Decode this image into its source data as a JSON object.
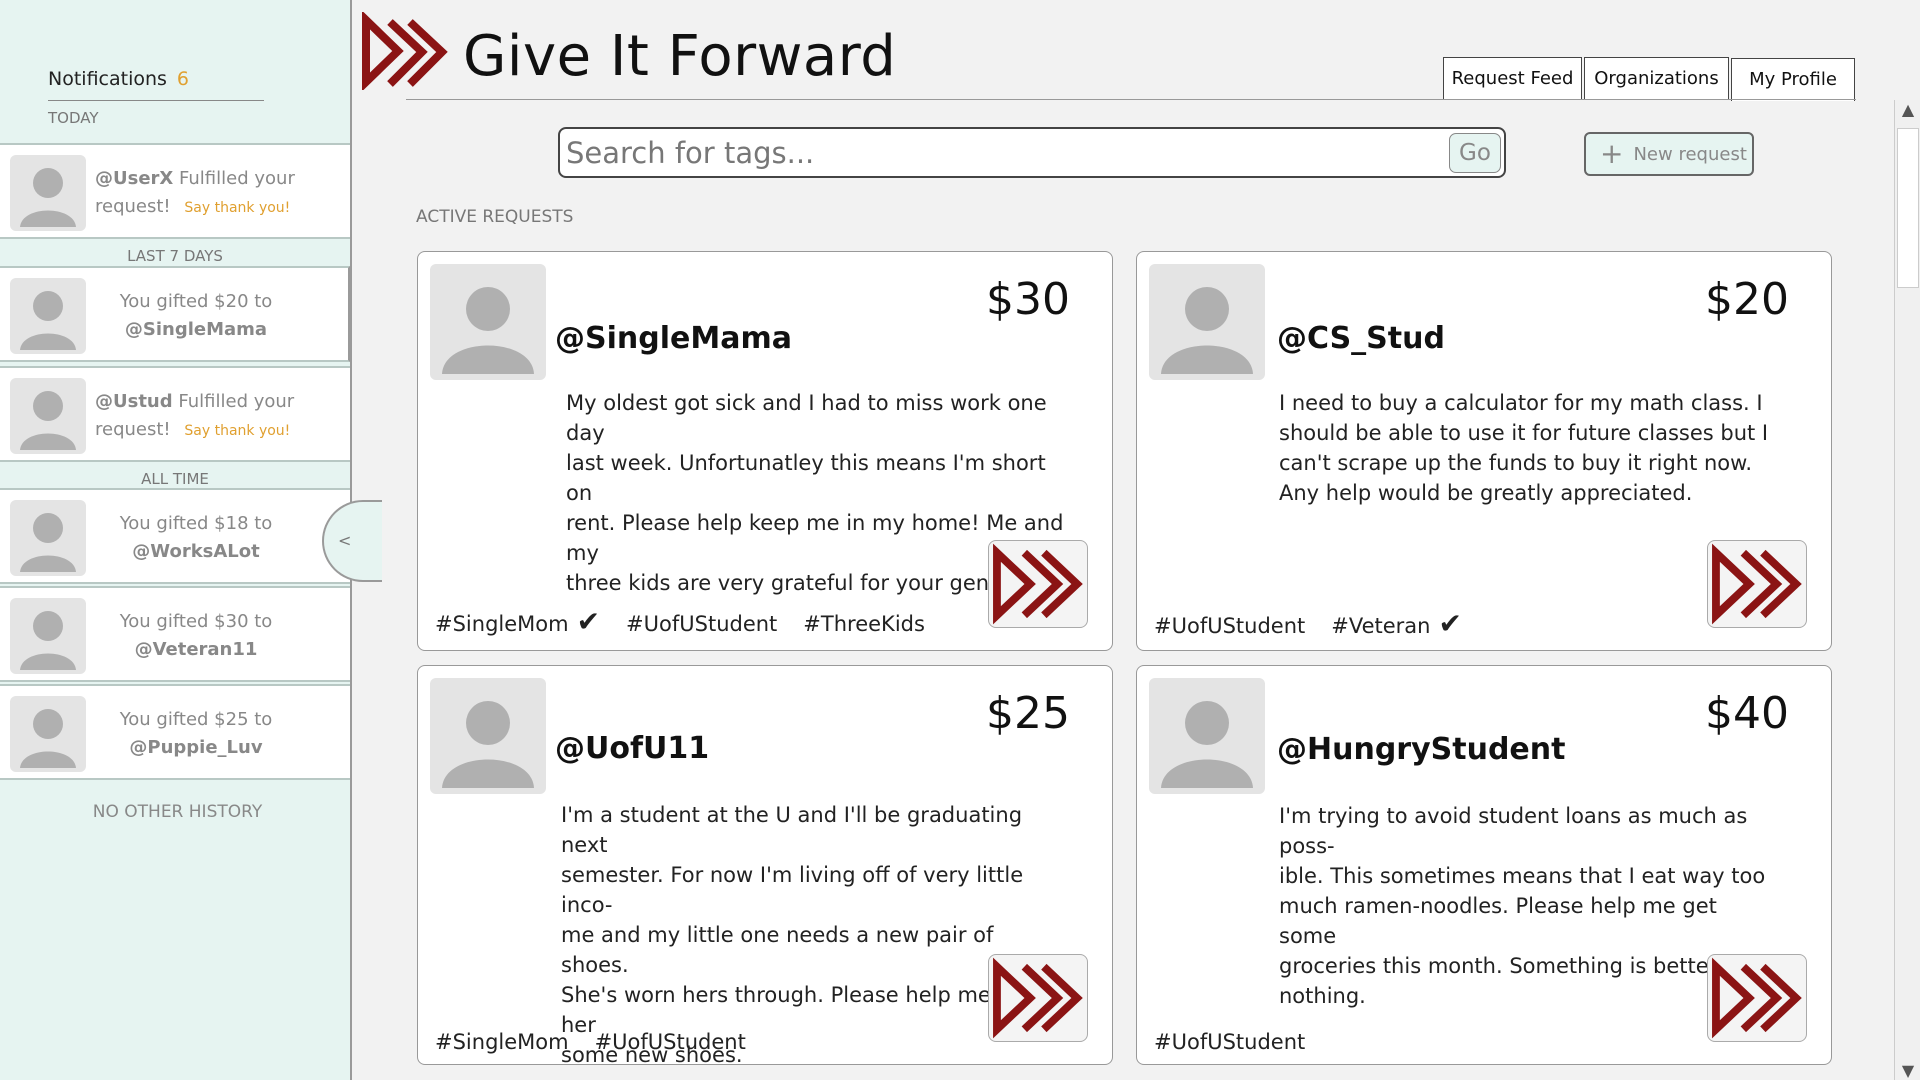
{
  "sidebar": {
    "title": "Notifications",
    "count": "6",
    "sections": {
      "today": "TODAY",
      "last7": "LAST 7 DAYS",
      "alltime": "ALL TIME"
    },
    "items": [
      {
        "user": "@UserX",
        "text": "Fulfilled your request!",
        "thanks": "Say thank you!"
      },
      {
        "prefix": "You gifted $20 to",
        "user": "@SingleMama"
      },
      {
        "user": "@Ustud",
        "text": "Fulfilled your request!",
        "thanks": "Say thank you!"
      },
      {
        "prefix": "You gifted $18 to",
        "user": "@WorksALot"
      },
      {
        "prefix": "You gifted $30 to",
        "user": "@Veteran11"
      },
      {
        "prefix": "You gifted $25 to",
        "user": "@Puppie_Luv"
      }
    ],
    "collapse_glyph": "<",
    "no_history": "NO OTHER HISTORY"
  },
  "header": {
    "title": "Give It Forward",
    "tabs": [
      "Request Feed",
      "Organizations",
      "My Profile"
    ]
  },
  "search": {
    "placeholder": "Search for tags...",
    "go_label": "Go"
  },
  "new_request_label": "New request",
  "active_label": "ACTIVE REQUESTS",
  "cards": [
    {
      "user": "@SingleMama",
      "amount": "$30",
      "desc_lines": [
        "My oldest got sick and I had to miss work one day",
        "last week. Unfortunatley this means I'm short on",
        "rent. Please help keep me in my home! Me and my",
        "three kids are very grateful for your generosity."
      ],
      "tags": [
        "#SingleMom",
        "#UofUStudent",
        "#ThreeKids"
      ]
    },
    {
      "user": "@CS_Stud",
      "amount": "$20",
      "desc_lines": [
        "I need to buy a calculator for my math class. I",
        "should be able to use it for future classes but I",
        "can't scrape up the funds to buy it right now.",
        "Any help would be greatly appreciated."
      ],
      "tags": [
        "#UofUStudent",
        "#Veteran"
      ]
    },
    {
      "user": "@UofU11",
      "amount": "$25",
      "desc_lines": [
        "I'm a student at the U and I'll be graduating next",
        "semester. For now I'm living off of very little inco-",
        "me and my little one needs a new pair of shoes.",
        "She's worn hers through. Please help me buy her",
        "some new shoes."
      ],
      "tags": [
        "#SingleMom",
        "#UofUStudent"
      ]
    },
    {
      "user": "@HungryStudent",
      "amount": "$40",
      "desc_lines": [
        "I'm trying to avoid student loans as much as poss-",
        "ible. This sometimes means that I eat way too",
        "much ramen-noodles. Please help me get some",
        "groceries this month. Something is better then",
        "nothing."
      ],
      "tags": [
        "#UofUStudent"
      ]
    }
  ],
  "check_glyph": "✔",
  "colors": {
    "brand": "#8b1414",
    "sidebar_bg": "#e6f4f1",
    "accent_orange": "#e0a030"
  },
  "icons": {
    "logo": "forward-arrows-icon",
    "avatar": "user-silhouette-icon",
    "add": "plus-icon"
  }
}
